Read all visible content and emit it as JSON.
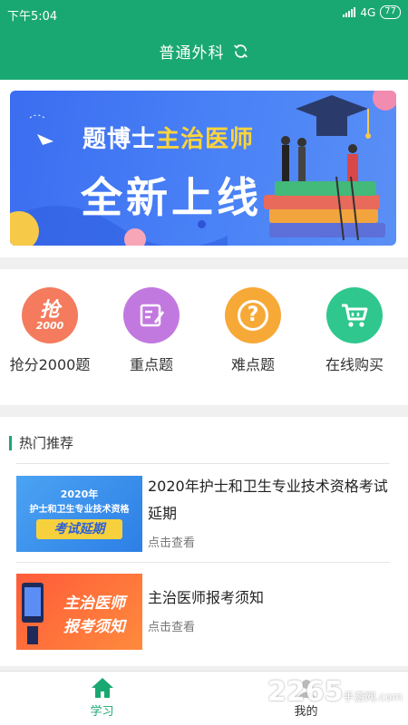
{
  "status_bar": {
    "time": "下午5:04",
    "network": "4G",
    "battery": "77"
  },
  "header": {
    "title": "普通外科",
    "refresh_icon": "refresh-icon"
  },
  "banner": {
    "line1_prefix": "题博士",
    "line1_highlight": "主治医师",
    "line2": "全新上线"
  },
  "menu": {
    "items": [
      {
        "label": "抢分2000题",
        "icon": "grab-icon",
        "icon_text": "抢",
        "icon_subtext": "2000",
        "color": "#f47b5d"
      },
      {
        "label": "重点题",
        "icon": "edit-icon",
        "color": "#c279df"
      },
      {
        "label": "难点题",
        "icon": "question-icon",
        "icon_text": "?",
        "color": "#f7a938"
      },
      {
        "label": "在线购买",
        "icon": "cart-icon",
        "color": "#2fc78d"
      }
    ]
  },
  "recommend": {
    "title": "热门推荐",
    "articles": [
      {
        "thumb_year": "2020年",
        "thumb_line": "护士和卫生专业技术资格",
        "thumb_tag": "考试延期",
        "title": "2020年护士和卫生专业技术资格考试延期",
        "sub": "点击查看"
      },
      {
        "thumb_line1": "主治医师",
        "thumb_line2": "报考须知",
        "title": "主治医师报考须知",
        "sub": "点击查看"
      }
    ]
  },
  "tabbar": {
    "tabs": [
      {
        "label": "学习",
        "icon": "home-icon",
        "active": true
      },
      {
        "label": "我的",
        "icon": "user-icon",
        "active": false
      }
    ]
  },
  "watermark": {
    "text": "2265",
    "suffix": "手游网",
    "domain": ".com"
  },
  "colors": {
    "primary": "#1aa872",
    "banner_blue": "#3b6df0",
    "highlight": "#ffd43b"
  }
}
